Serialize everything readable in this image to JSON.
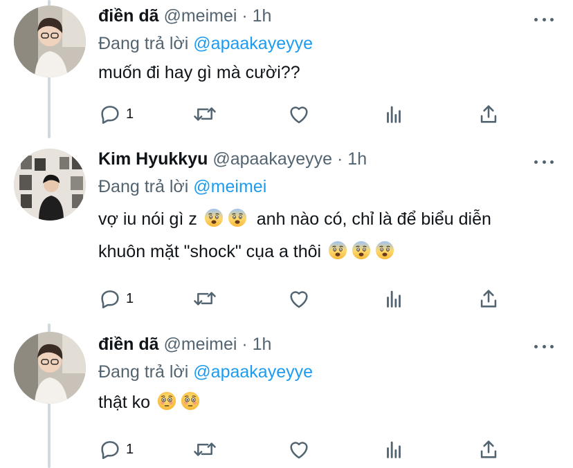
{
  "colors": {
    "accent": "#1d9bf0",
    "secondary_text": "#536471",
    "thread_line": "#cfd9de"
  },
  "tweets": [
    {
      "name": "điền dã",
      "handle": "@meimei",
      "separator": "·",
      "time": "1h",
      "replying_prefix": "Đang trả lời",
      "replying_to": "@apaakayeyye",
      "text_parts": [
        "muốn đi hay gì mà cười??"
      ],
      "reply_count": "1"
    },
    {
      "name": "Kim Hyukkyu",
      "handle": "@apaakayeyye",
      "separator": "·",
      "time": "1h",
      "replying_prefix": "Đang trả lời",
      "replying_to": "@meimei",
      "text_parts": [
        "vợ iu nói gì z",
        "anh nào có, chỉ là để biểu diễn",
        "khuôn mặt \"shock\" cụa a thôi"
      ],
      "reply_count": "1"
    },
    {
      "name": "điền dã",
      "handle": "@meimei",
      "separator": "·",
      "time": "1h",
      "replying_prefix": "Đang trả lời",
      "replying_to": "@apaakayeyye",
      "text_parts": [
        "thật ko"
      ],
      "reply_count": "1"
    }
  ],
  "icons": [
    "more-icon",
    "reply-icon",
    "retweet-icon",
    "like-icon",
    "analytics-icon",
    "share-icon",
    "fearful-face-emoji",
    "flushed-face-emoji"
  ]
}
